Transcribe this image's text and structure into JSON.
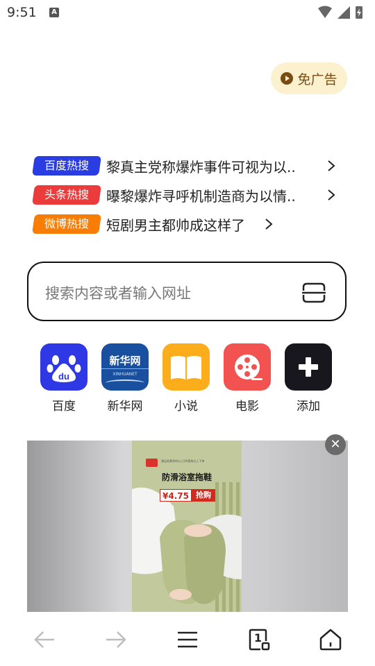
{
  "status": {
    "time": "9:51",
    "notification_badge": "A"
  },
  "ad_free": {
    "label": "免广告"
  },
  "hot_list": [
    {
      "source": "百度热搜",
      "color": "#2a3de3",
      "headline": "黎真主党称爆炸事件可视为以.."
    },
    {
      "source": "头条热搜",
      "color": "#ec3b3b",
      "headline": "曝黎爆炸寻呼机制造商为以情.."
    },
    {
      "source": "微博热搜",
      "color": "#f77d06",
      "headline": "短剧男主都帅成这样了"
    }
  ],
  "search": {
    "placeholder": "搜索内容或者输入网址"
  },
  "shortcuts": [
    {
      "label": "百度",
      "icon": "baidu-paw-icon",
      "color": "#2e38e5"
    },
    {
      "label": "新华网",
      "icon": "xinhua-logo-icon",
      "color": "#18509f",
      "logo_text": "新华网",
      "logo_sub": "XINHUANET"
    },
    {
      "label": "小说",
      "icon": "book-icon",
      "color": "#fbad1b"
    },
    {
      "label": "电影",
      "icon": "film-reel-icon",
      "color": "#f35350"
    },
    {
      "label": "添加",
      "icon": "plus-icon",
      "color": "#17171d"
    }
  ],
  "ad": {
    "title": "防滑浴室拖鞋",
    "price": "¥4.75",
    "buy": "抢购",
    "small_text": "满足低需求的以上5件套装以上下单",
    "close": "✕"
  },
  "bottom_nav": {
    "tab_count": "1",
    "buttons": [
      "back",
      "forward",
      "menu",
      "tabs",
      "home"
    ]
  }
}
